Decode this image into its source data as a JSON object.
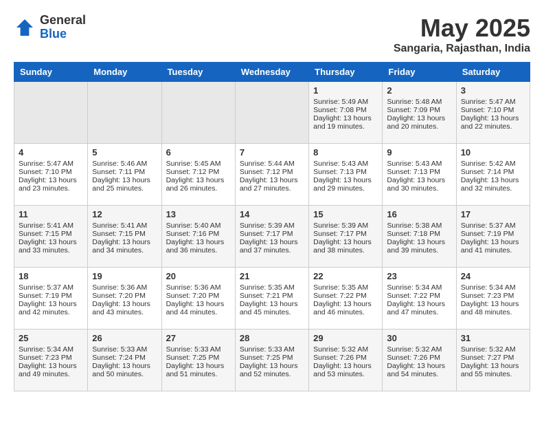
{
  "logo": {
    "general": "General",
    "blue": "Blue"
  },
  "title": "May 2025",
  "location": "Sangaria, Rajasthan, India",
  "days_of_week": [
    "Sunday",
    "Monday",
    "Tuesday",
    "Wednesday",
    "Thursday",
    "Friday",
    "Saturday"
  ],
  "weeks": [
    [
      {
        "day": "",
        "content": ""
      },
      {
        "day": "",
        "content": ""
      },
      {
        "day": "",
        "content": ""
      },
      {
        "day": "",
        "content": ""
      },
      {
        "day": "1",
        "content": "Sunrise: 5:49 AM\nSunset: 7:08 PM\nDaylight: 13 hours\nand 19 minutes."
      },
      {
        "day": "2",
        "content": "Sunrise: 5:48 AM\nSunset: 7:09 PM\nDaylight: 13 hours\nand 20 minutes."
      },
      {
        "day": "3",
        "content": "Sunrise: 5:47 AM\nSunset: 7:10 PM\nDaylight: 13 hours\nand 22 minutes."
      }
    ],
    [
      {
        "day": "4",
        "content": "Sunrise: 5:47 AM\nSunset: 7:10 PM\nDaylight: 13 hours\nand 23 minutes."
      },
      {
        "day": "5",
        "content": "Sunrise: 5:46 AM\nSunset: 7:11 PM\nDaylight: 13 hours\nand 25 minutes."
      },
      {
        "day": "6",
        "content": "Sunrise: 5:45 AM\nSunset: 7:12 PM\nDaylight: 13 hours\nand 26 minutes."
      },
      {
        "day": "7",
        "content": "Sunrise: 5:44 AM\nSunset: 7:12 PM\nDaylight: 13 hours\nand 27 minutes."
      },
      {
        "day": "8",
        "content": "Sunrise: 5:43 AM\nSunset: 7:13 PM\nDaylight: 13 hours\nand 29 minutes."
      },
      {
        "day": "9",
        "content": "Sunrise: 5:43 AM\nSunset: 7:13 PM\nDaylight: 13 hours\nand 30 minutes."
      },
      {
        "day": "10",
        "content": "Sunrise: 5:42 AM\nSunset: 7:14 PM\nDaylight: 13 hours\nand 32 minutes."
      }
    ],
    [
      {
        "day": "11",
        "content": "Sunrise: 5:41 AM\nSunset: 7:15 PM\nDaylight: 13 hours\nand 33 minutes."
      },
      {
        "day": "12",
        "content": "Sunrise: 5:41 AM\nSunset: 7:15 PM\nDaylight: 13 hours\nand 34 minutes."
      },
      {
        "day": "13",
        "content": "Sunrise: 5:40 AM\nSunset: 7:16 PM\nDaylight: 13 hours\nand 36 minutes."
      },
      {
        "day": "14",
        "content": "Sunrise: 5:39 AM\nSunset: 7:17 PM\nDaylight: 13 hours\nand 37 minutes."
      },
      {
        "day": "15",
        "content": "Sunrise: 5:39 AM\nSunset: 7:17 PM\nDaylight: 13 hours\nand 38 minutes."
      },
      {
        "day": "16",
        "content": "Sunrise: 5:38 AM\nSunset: 7:18 PM\nDaylight: 13 hours\nand 39 minutes."
      },
      {
        "day": "17",
        "content": "Sunrise: 5:37 AM\nSunset: 7:19 PM\nDaylight: 13 hours\nand 41 minutes."
      }
    ],
    [
      {
        "day": "18",
        "content": "Sunrise: 5:37 AM\nSunset: 7:19 PM\nDaylight: 13 hours\nand 42 minutes."
      },
      {
        "day": "19",
        "content": "Sunrise: 5:36 AM\nSunset: 7:20 PM\nDaylight: 13 hours\nand 43 minutes."
      },
      {
        "day": "20",
        "content": "Sunrise: 5:36 AM\nSunset: 7:20 PM\nDaylight: 13 hours\nand 44 minutes."
      },
      {
        "day": "21",
        "content": "Sunrise: 5:35 AM\nSunset: 7:21 PM\nDaylight: 13 hours\nand 45 minutes."
      },
      {
        "day": "22",
        "content": "Sunrise: 5:35 AM\nSunset: 7:22 PM\nDaylight: 13 hours\nand 46 minutes."
      },
      {
        "day": "23",
        "content": "Sunrise: 5:34 AM\nSunset: 7:22 PM\nDaylight: 13 hours\nand 47 minutes."
      },
      {
        "day": "24",
        "content": "Sunrise: 5:34 AM\nSunset: 7:23 PM\nDaylight: 13 hours\nand 48 minutes."
      }
    ],
    [
      {
        "day": "25",
        "content": "Sunrise: 5:34 AM\nSunset: 7:23 PM\nDaylight: 13 hours\nand 49 minutes."
      },
      {
        "day": "26",
        "content": "Sunrise: 5:33 AM\nSunset: 7:24 PM\nDaylight: 13 hours\nand 50 minutes."
      },
      {
        "day": "27",
        "content": "Sunrise: 5:33 AM\nSunset: 7:25 PM\nDaylight: 13 hours\nand 51 minutes."
      },
      {
        "day": "28",
        "content": "Sunrise: 5:33 AM\nSunset: 7:25 PM\nDaylight: 13 hours\nand 52 minutes."
      },
      {
        "day": "29",
        "content": "Sunrise: 5:32 AM\nSunset: 7:26 PM\nDaylight: 13 hours\nand 53 minutes."
      },
      {
        "day": "30",
        "content": "Sunrise: 5:32 AM\nSunset: 7:26 PM\nDaylight: 13 hours\nand 54 minutes."
      },
      {
        "day": "31",
        "content": "Sunrise: 5:32 AM\nSunset: 7:27 PM\nDaylight: 13 hours\nand 55 minutes."
      }
    ]
  ]
}
